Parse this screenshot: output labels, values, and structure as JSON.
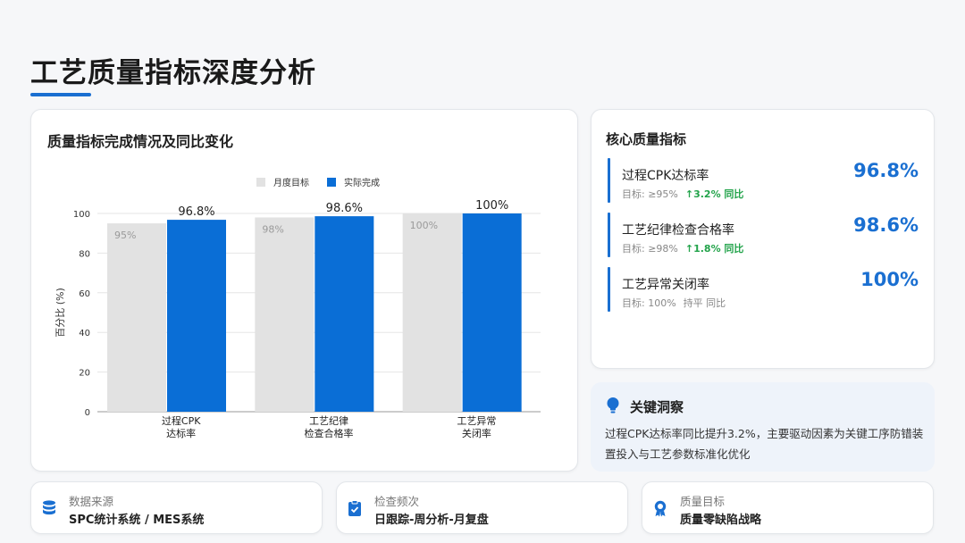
{
  "page": {
    "title": "工艺质量指标深度分析"
  },
  "chart": {
    "card_title": "质量指标完成情况及同比变化"
  },
  "chart_data": {
    "type": "bar",
    "categories": [
      [
        "过程CPK",
        "达标率"
      ],
      [
        "工艺纪律",
        "检查合格率"
      ],
      [
        "工艺异常",
        "关闭率"
      ]
    ],
    "series": [
      {
        "name": "月度目标",
        "values": [
          95,
          98,
          100
        ],
        "labels": [
          "95%",
          "98%",
          "100%"
        ],
        "color": "#e2e2e2"
      },
      {
        "name": "实际完成",
        "values": [
          96.8,
          98.6,
          100
        ],
        "labels": [
          "96.8%",
          "98.6%",
          "100%"
        ],
        "color": "#0a6ed6"
      }
    ],
    "ylabel": "百分比 (%)",
    "ylim": [
      0,
      100
    ],
    "yticks": [
      0,
      20,
      40,
      60,
      80,
      100
    ],
    "grid": true,
    "legend": "top"
  },
  "kpi": {
    "title": "核心质量指标",
    "items": [
      {
        "name": "过程CPK达标率",
        "value": "96.8%",
        "target": "目标: ≥95%",
        "change": "↑3.2% 同比",
        "trend": "up"
      },
      {
        "name": "工艺纪律检查合格率",
        "value": "98.6%",
        "target": "目标: ≥98%",
        "change": "↑1.8% 同比",
        "trend": "up"
      },
      {
        "name": "工艺异常关闭率",
        "value": "100%",
        "target": "目标: 100%",
        "change": "持平 同比",
        "trend": "flat"
      }
    ]
  },
  "insight": {
    "title": "关键洞察",
    "text": "过程CPK达标率同比提升3.2%，主要驱动因素为关键工序防错装置投入与工艺参数标准化优化"
  },
  "footer": [
    {
      "label": "数据来源",
      "value": "SPC统计系统 / MES系统",
      "icon": "database-icon"
    },
    {
      "label": "检查频次",
      "value": "日跟踪-周分析-月复盘",
      "icon": "clipboard-check-icon"
    },
    {
      "label": "质量目标",
      "value": "质量零缺陷战略",
      "icon": "award-icon"
    }
  ],
  "colors": {
    "accent": "#1a6fd1",
    "positive": "#22a34a"
  }
}
